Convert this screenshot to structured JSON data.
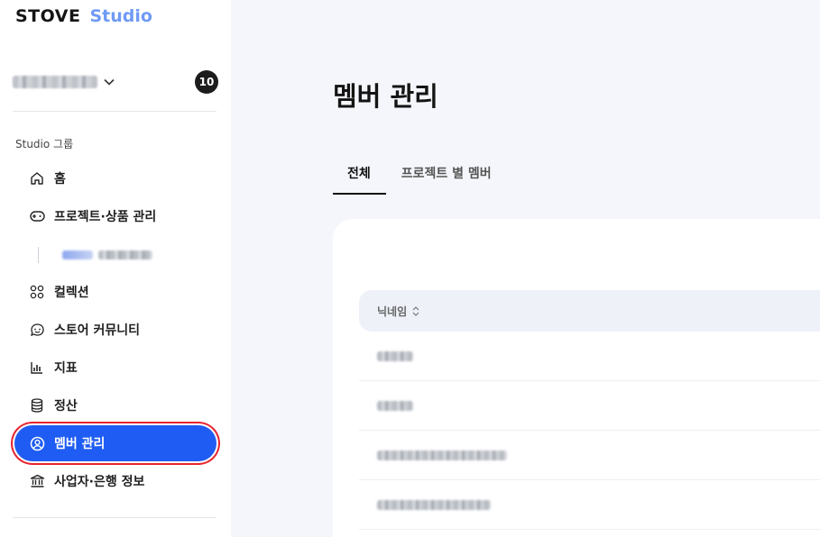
{
  "brand": {
    "stove": "STOVE",
    "studio": "Studio",
    "studio_color": "#6f9af5"
  },
  "org": {
    "badge": "10"
  },
  "sidebar": {
    "group_label": "Studio 그룹",
    "items": [
      {
        "label": "홈",
        "icon": "home-icon"
      },
      {
        "label": "프로젝트·상품 관리",
        "icon": "gamepad-icon"
      },
      {
        "label": "컬렉션",
        "icon": "collection-icon"
      },
      {
        "label": "스토어 커뮤니티",
        "icon": "community-icon"
      },
      {
        "label": "지표",
        "icon": "chart-icon"
      },
      {
        "label": "정산",
        "icon": "database-icon"
      },
      {
        "label": "멤버 관리",
        "icon": "user-circle-icon",
        "active": true
      },
      {
        "label": "사업자·은행 정보",
        "icon": "bank-icon"
      }
    ],
    "accent": "#1f5cf3",
    "highlight": "#e8242f"
  },
  "main": {
    "title": "멤버 관리",
    "tabs": [
      {
        "label": "전체",
        "active": true
      },
      {
        "label": "프로젝트 별 멤버",
        "active": false
      }
    ],
    "table": {
      "columns": [
        "닉네임"
      ]
    }
  }
}
